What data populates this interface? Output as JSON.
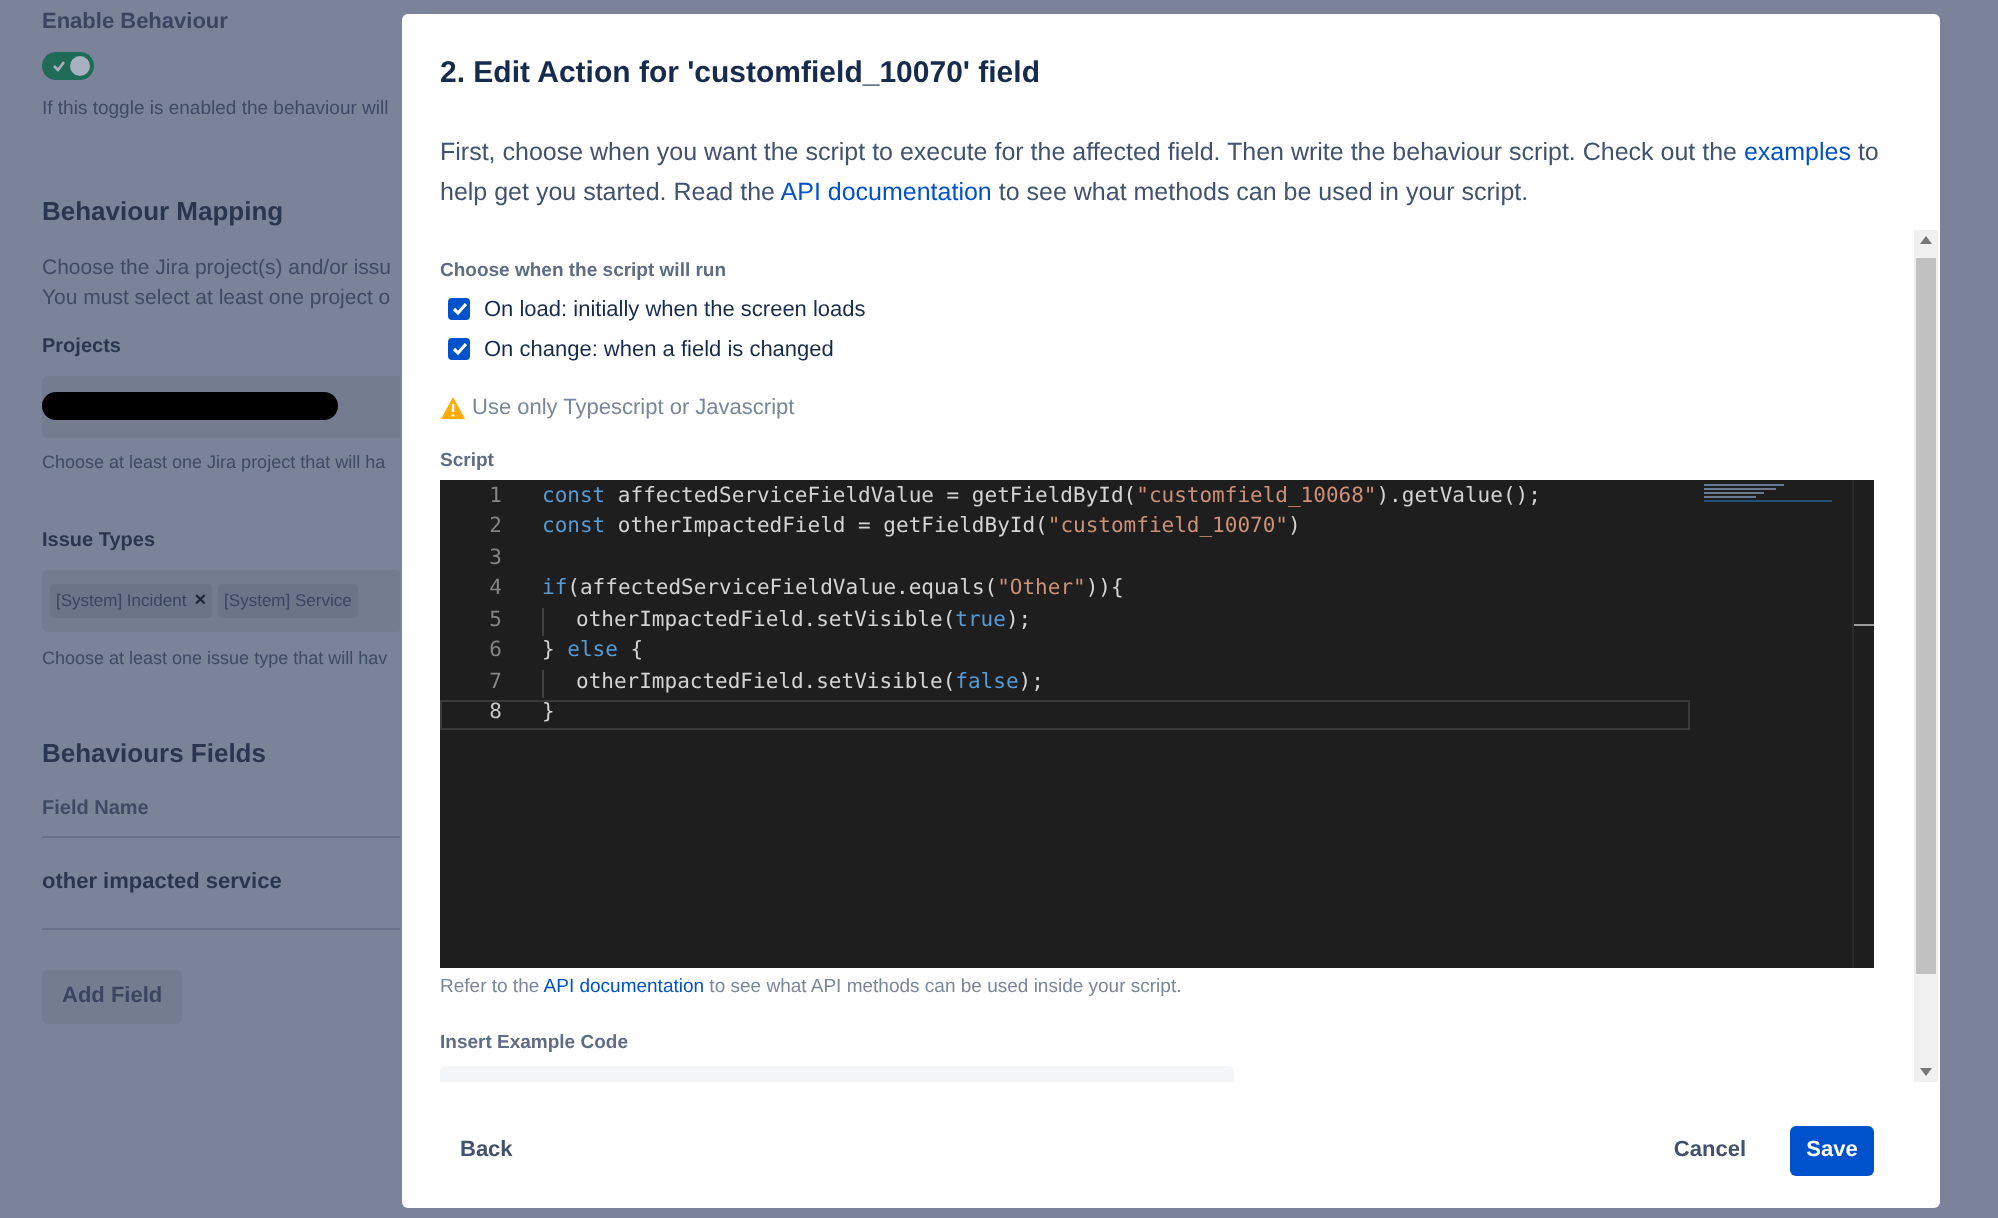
{
  "background_page": {
    "enable_label": "Enable Behaviour",
    "toggle": {
      "on": true
    },
    "toggle_hint": "If this toggle is enabled the behaviour will",
    "mapping_title": "Behaviour Mapping",
    "mapping_text": [
      "Choose the Jira project(s) and/or issu",
      "You must select at least one project o"
    ],
    "projects_label": "Projects",
    "projects_hint": "Choose at least one Jira project that will ha",
    "issue_types_label": "Issue Types",
    "issue_types": [
      {
        "label": "[System] Incident",
        "remove": "×"
      },
      {
        "label": "[System] Service"
      }
    ],
    "issue_types_hint": "Choose at least one issue type that will hav",
    "fields_title": "Behaviours Fields",
    "fields_column": "Field Name",
    "fields": [
      "other impacted service"
    ],
    "add_button": "Add Field"
  },
  "modal": {
    "title": "2. Edit Action for 'customfield_10070' field",
    "intro": [
      {
        "kind": "text",
        "text": "First, choose when you want the script to execute for the affected field. Then write the behaviour script. Check out the "
      },
      {
        "kind": "link",
        "text": "examples"
      },
      {
        "kind": "text",
        "text": " to help get you started. Read the "
      },
      {
        "kind": "link",
        "text": "API documentation"
      },
      {
        "kind": "text",
        "text": " to see what methods can be used in your script."
      }
    ],
    "run_label": "Choose when the script will run",
    "run_options": [
      {
        "label": "On load: initially when the screen loads",
        "checked": true
      },
      {
        "label": "On change: when a field is changed",
        "checked": true
      }
    ],
    "warning": "Use only Typescript or Javascript",
    "script_label": "Script",
    "code": [
      {
        "number": "1",
        "current": false,
        "indented": false,
        "tokens": [
          {
            "kind": "keyword",
            "text": "const"
          },
          {
            "kind": "plain",
            "text": " affectedServiceFieldValue = getFieldById("
          },
          {
            "kind": "string",
            "text": "\"customfield_10068\""
          },
          {
            "kind": "plain",
            "text": ").getValue();"
          }
        ]
      },
      {
        "number": "2",
        "current": false,
        "indented": false,
        "tokens": [
          {
            "kind": "keyword",
            "text": "const"
          },
          {
            "kind": "plain",
            "text": " otherImpactedField = getFieldById("
          },
          {
            "kind": "string",
            "text": "\"customfield_10070\""
          },
          {
            "kind": "plain",
            "text": ")"
          }
        ]
      },
      {
        "number": "3",
        "current": false,
        "indented": false
      },
      {
        "number": "4",
        "current": false,
        "indented": false,
        "tokens": [
          {
            "kind": "keyword",
            "text": "if"
          },
          {
            "kind": "plain",
            "text": "(affectedServiceFieldValue.equals("
          },
          {
            "kind": "string",
            "text": "\"Other\""
          },
          {
            "kind": "plain",
            "text": ")){"
          }
        ]
      },
      {
        "number": "5",
        "current": false,
        "indented": true,
        "tokens": [
          {
            "kind": "plain",
            "text": "otherImpactedField.setVisible("
          },
          {
            "kind": "keyword",
            "text": "true"
          },
          {
            "kind": "plain",
            "text": ");"
          }
        ]
      },
      {
        "number": "6",
        "current": false,
        "indented": false,
        "tokens": [
          {
            "kind": "plain",
            "text": "} "
          },
          {
            "kind": "keyword",
            "text": "else"
          },
          {
            "kind": "plain",
            "text": " {"
          }
        ]
      },
      {
        "number": "7",
        "current": false,
        "indented": true,
        "tokens": [
          {
            "kind": "plain",
            "text": "otherImpactedField.setVisible("
          },
          {
            "kind": "keyword",
            "text": "false"
          },
          {
            "kind": "plain",
            "text": ");"
          }
        ]
      },
      {
        "number": "8",
        "current": true,
        "indented": false,
        "tokens": [
          {
            "kind": "plain",
            "text": "}"
          }
        ]
      }
    ],
    "api_hint": [
      {
        "kind": "text",
        "text": "Refer to the "
      },
      {
        "kind": "link",
        "text": "API documentation"
      },
      {
        "kind": "text",
        "text": " to see what API methods can be used inside your script."
      }
    ],
    "example_label": "Insert Example Code",
    "back": "Back",
    "cancel": "Cancel",
    "save": "Save"
  }
}
